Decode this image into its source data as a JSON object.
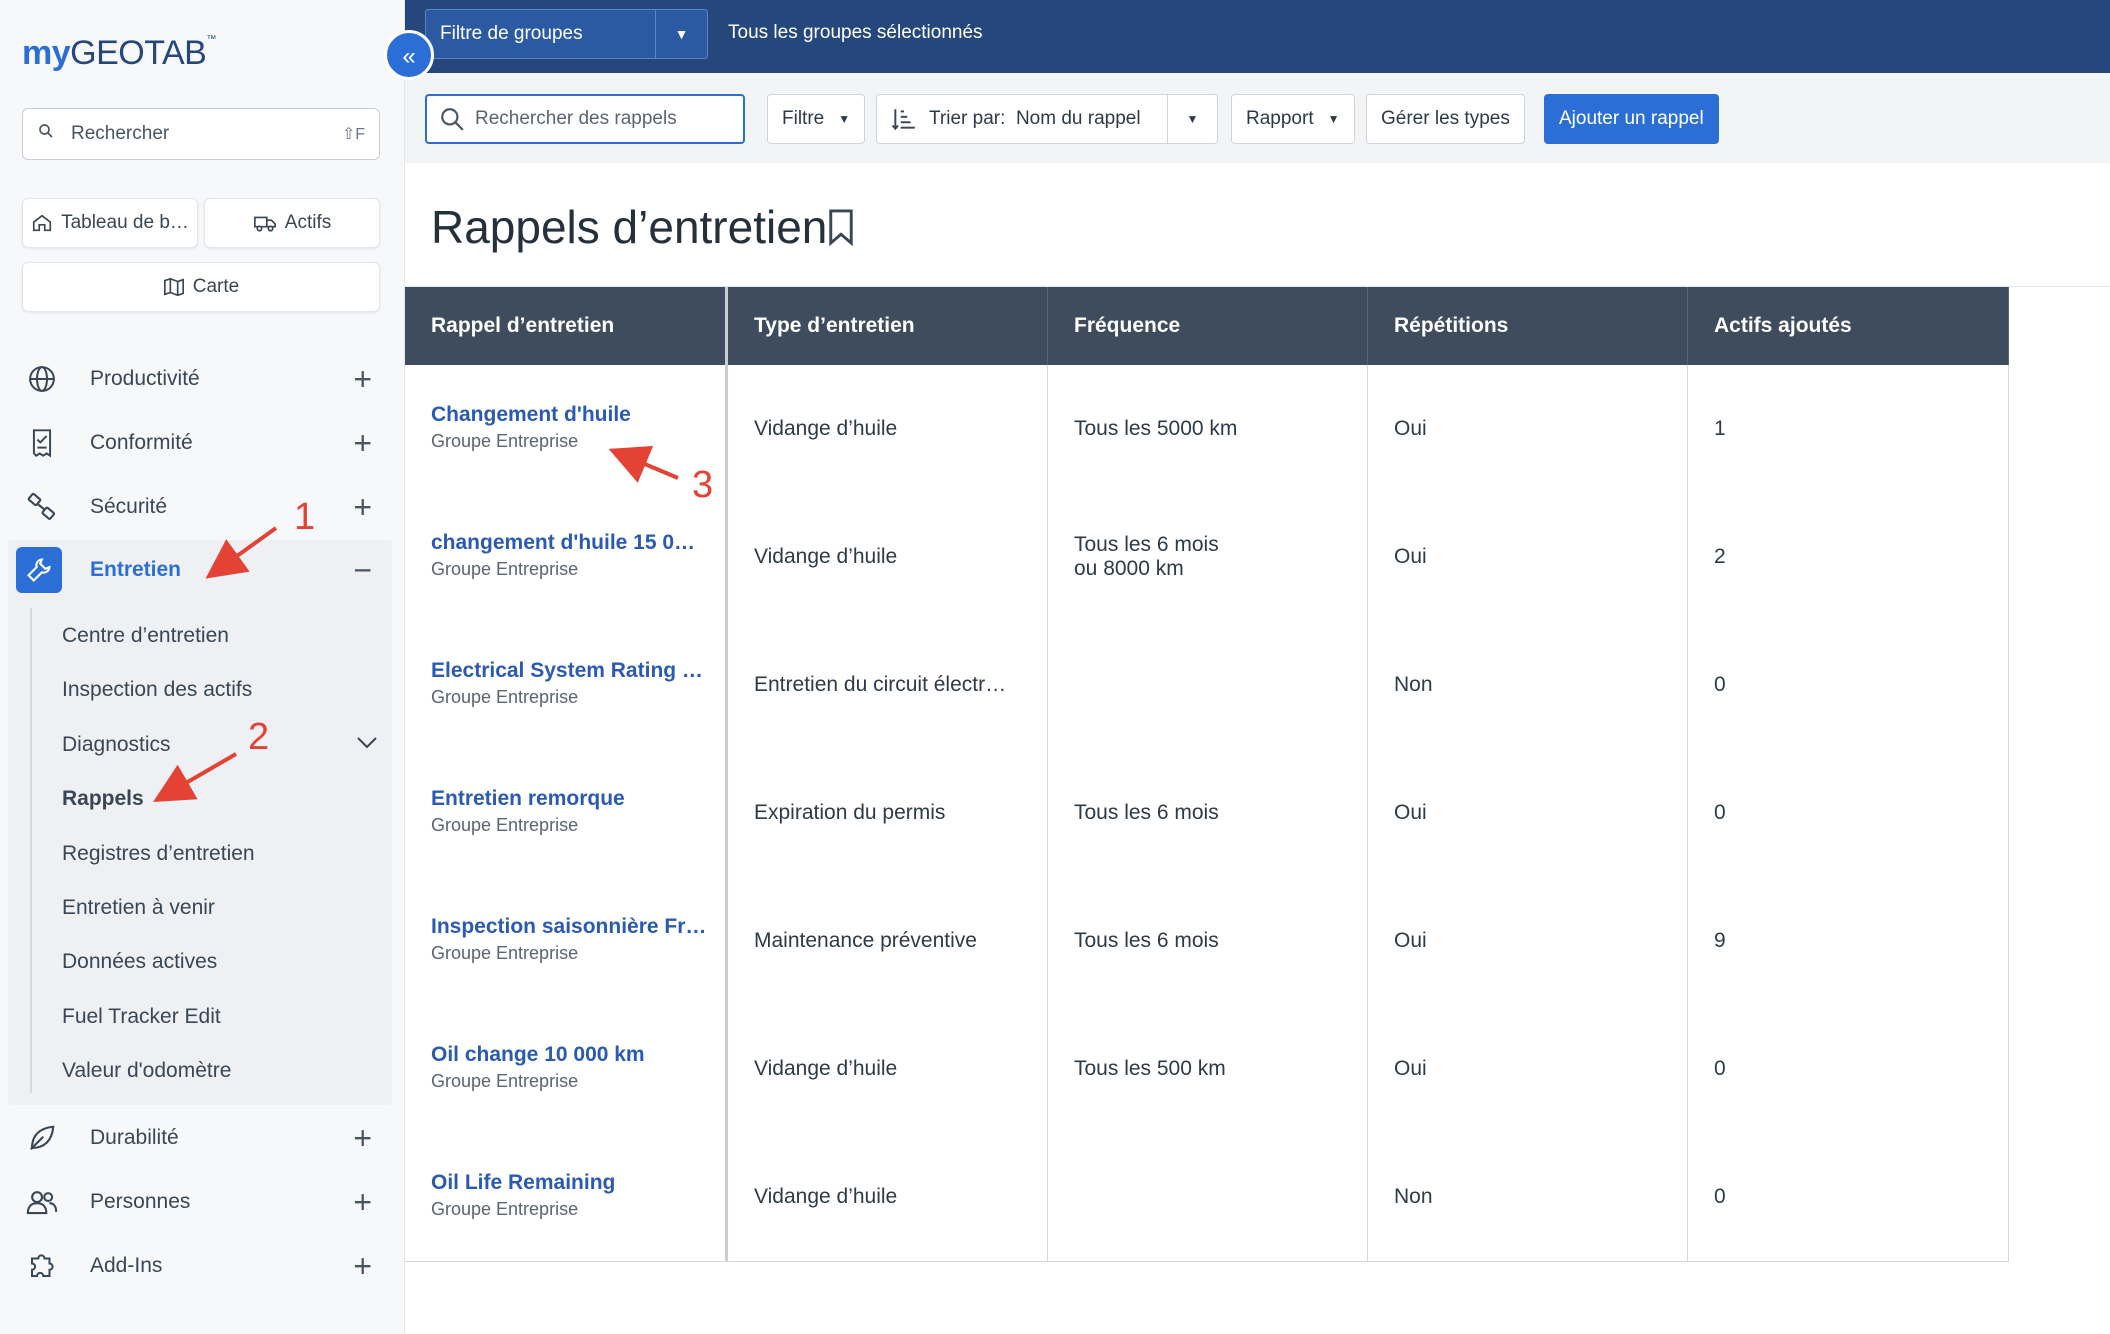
{
  "sidebar": {
    "logo": {
      "my": "my",
      "geotab": "GEOTAB",
      "tm": "™"
    },
    "collapse_label": "«",
    "search": {
      "placeholder": "Rechercher",
      "shortcut": "⇧F"
    },
    "quick": {
      "dashboard": "Tableau de b…",
      "assets": "Actifs",
      "map": "Carte"
    },
    "nav": {
      "productivity": "Productivité",
      "compliance": "Conformité",
      "safety": "Sécurité",
      "maintenance": "Entretien",
      "sustainability": "Durabilité",
      "people": "Personnes",
      "addins": "Add-Ins"
    },
    "maintenance_sub": [
      "Centre d’entretien",
      "Inspection des actifs",
      "Diagnostics",
      "Rappels",
      "Registres d’entretien",
      "Entretien à venir",
      "Données actives",
      "Fuel Tracker Edit",
      "Valeur d'odomètre"
    ]
  },
  "topbar": {
    "group_filter": "Filtre de groupes",
    "group_text": "Tous les groupes sélectionnés"
  },
  "toolbar": {
    "search_placeholder": "Rechercher des rappels",
    "filter": "Filtre",
    "sort_prefix": "Trier par:",
    "sort_value": "Nom du rappel",
    "report": "Rapport",
    "manage_types": "Gérer les types",
    "add": "Ajouter un rappel"
  },
  "page": {
    "title": "Rappels d’entretien"
  },
  "table": {
    "headers": [
      "Rappel d’entretien",
      "Type d’entretien",
      "Fréquence",
      "Répétitions",
      "Actifs ajoutés"
    ],
    "rows": [
      {
        "name": "Changement d'huile",
        "group": "Groupe Entreprise",
        "type": "Vidange d’huile",
        "freq1": "Tous les 5000 km",
        "freq2": "",
        "repeat": "Oui",
        "assets": "1"
      },
      {
        "name": "changement d'huile 15 0…",
        "group": "Groupe Entreprise",
        "type": "Vidange d’huile",
        "freq1": "Tous les 6 mois",
        "freq2": "ou 8000 km",
        "repeat": "Oui",
        "assets": "2"
      },
      {
        "name": "Electrical System Rating …",
        "group": "Groupe Entreprise",
        "type": "Entretien du circuit électr…",
        "freq1": "",
        "freq2": "",
        "repeat": "Non",
        "assets": "0"
      },
      {
        "name": "Entretien remorque",
        "group": "Groupe Entreprise",
        "type": "Expiration du permis",
        "freq1": "Tous les 6 mois",
        "freq2": "",
        "repeat": "Oui",
        "assets": "0"
      },
      {
        "name": "Inspection saisonnière Fr…",
        "group": "Groupe Entreprise",
        "type": "Maintenance préventive",
        "freq1": "Tous les 6 mois",
        "freq2": "",
        "repeat": "Oui",
        "assets": "9"
      },
      {
        "name": "Oil change 10 000 km",
        "group": "Groupe Entreprise",
        "type": "Vidange d’huile",
        "freq1": "Tous les 500 km",
        "freq2": "",
        "repeat": "Oui",
        "assets": "0"
      },
      {
        "name": "Oil Life Remaining",
        "group": "Groupe Entreprise",
        "type": "Vidange d’huile",
        "freq1": "",
        "freq2": "",
        "repeat": "Non",
        "assets": "0"
      }
    ]
  },
  "annotations": {
    "a1": "1",
    "a2": "2",
    "a3": "3"
  },
  "colors": {
    "accent": "#2b6fd6",
    "topbar": "#25477b",
    "header": "#3e4c5e",
    "annotation": "#e34234"
  }
}
